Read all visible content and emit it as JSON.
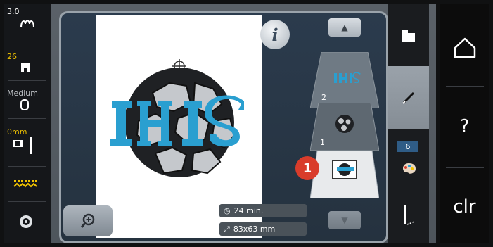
{
  "left_status": {
    "tension": "3.0",
    "presser_foot_number": "26",
    "thread_weight": "Medium",
    "offset": "0mm"
  },
  "workspace": {
    "info_label": "i",
    "time": "24 min.",
    "size": "83x63 mm",
    "design_text": "IHIS"
  },
  "layers": [
    {
      "number": "2",
      "state": "text"
    },
    {
      "number": "1",
      "state": "ball"
    }
  ],
  "badge": "1",
  "tools": {
    "color_count": "6"
  },
  "nav": {
    "help_label": "?",
    "clear_label": "clr"
  },
  "colors": {
    "accent_blue": "#2a9fd0",
    "badge_red": "#d93c2b",
    "yellow": "#f2c400"
  },
  "icons": [
    "frame-tension-icon",
    "presser-foot-icon",
    "thread-weight-icon",
    "needle-position-icon",
    "feed-dog-icon",
    "bobbin-icon",
    "info-icon",
    "zoom-icon",
    "clock-icon",
    "dimensions-icon",
    "arrow-up-icon",
    "arrow-down-icon",
    "folder-icon",
    "pen-edit-icon",
    "palette-icon",
    "stitch-icon",
    "home-icon"
  ]
}
